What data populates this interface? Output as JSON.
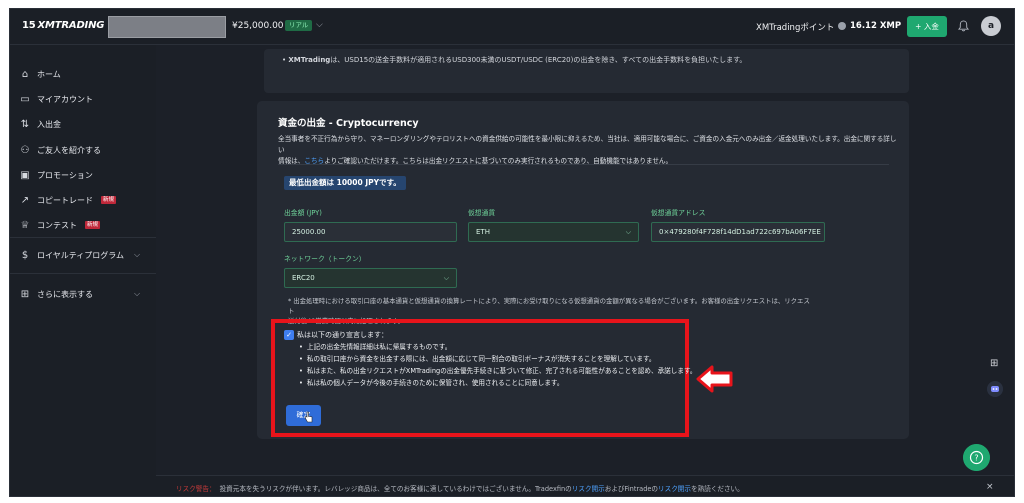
{
  "header": {
    "logo_num": "15",
    "logo_text": "XMTRADING",
    "balance": "¥25,000.00",
    "account_badge": "リアル",
    "points_label": "XMTradingポイント",
    "points_value": "16.12 XMP",
    "deposit_button": "+ 入金",
    "avatar_initial": "a"
  },
  "sidebar": {
    "items": [
      {
        "label": "ホーム"
      },
      {
        "label": "マイアカウント"
      },
      {
        "label": "入出金"
      },
      {
        "label": "ご友人を紹介する"
      },
      {
        "label": "プロモーション"
      },
      {
        "label": "コピートレード",
        "badge": "新規"
      },
      {
        "label": "コンテスト",
        "badge": "新規"
      },
      {
        "label": "ロイヤルティプログラム"
      },
      {
        "label": "さらに表示する"
      }
    ]
  },
  "top_card": {
    "text_bold": "XMTrading",
    "text": "は、USD15の送金手数料が適用されるUSD300未満のUSDT/USDC (ERC20)の出金を除き、すべての出金手数料を負担いたします。"
  },
  "withdraw": {
    "title": "資金の出金 - Cryptocurrency",
    "desc_1": "全当事者を不正行為から守り、マネーロンダリングやテロリストへの資金供給の可能性を最小限に抑えるため、当社は、適用可能な場合に、ご資金の入金元へのみ出金／返金処理いたします。出金に関する詳しい",
    "desc_2a": "情報は、",
    "desc_link": "こちら",
    "desc_2b": "よりご確認いただけます。こちらは出金リクエストに基づいてのみ実行されるものであり、自動機能ではありません。",
    "min_banner": "最低出金額は 10000 JPYです。",
    "amount_label": "出金額 (JPY)",
    "amount_value": "25000.00",
    "currency_label": "仮想通貨",
    "currency_value": "ETH",
    "address_label": "仮想通貨アドレス",
    "address_value": "0×479280f4F728f14dD1ad722c697bA06F7EE",
    "network_label": "ネットワーク（トークン）",
    "network_value": "ERC20",
    "note_1": "* 出金処理時における取引口座の基本通貨と仮想通貨の換算レートにより、実際にお受け取りになる仮想通貨の金額が異なる場合がございます。お客様の出金リクエストは、リクエスト",
    "note_2": "送付後48営業時間以内に処理されます。",
    "declaration_title": "私は以下の通り宣言します：",
    "declarations": [
      "上記の出金先情報詳細は私に帰属するものです。",
      "私の取引口座から資金を出金する際には、出金額に応じて同一割合の取引ボーナスが消失することを理解しています。",
      "私はまた、私の出金リクエストがXMTradingの出金優先手続きに基づいて修正、完了される可能性があることを認め、承諾します。",
      "私は私の個人データが今後の手続きのために保管され、使用されることに同意します。"
    ],
    "confirm_button": "確定"
  },
  "footer": {
    "risk_label": "リスク警告：",
    "risk_text_1": "投資元本を失うリスクが伴います。レバレッジ商品は、全てのお客様に適しているわけではございません。Tradexfinの",
    "risk_link_1": "リスク開示",
    "risk_text_2": "およびFintradeの",
    "risk_link_2": "リスク開示",
    "risk_text_3": "を熟読ください。",
    "close": "×"
  },
  "colors": {
    "accent_green": "#1fa870",
    "highlight_red": "#e8141b",
    "link_blue": "#4fa3ff"
  }
}
